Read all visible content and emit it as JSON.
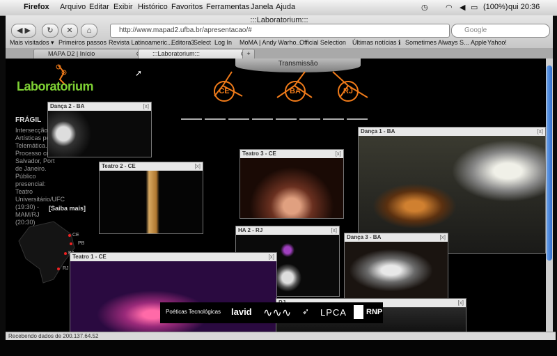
{
  "menubar": {
    "app": "Firefox",
    "items": [
      "Arquivo",
      "Editar",
      "Exibir",
      "Histórico",
      "Favoritos",
      "Ferramentas",
      "Janela",
      "Ajuda"
    ],
    "battery": "(100%)",
    "clock": "qui 20:36"
  },
  "window": {
    "title": ":::Laboratorium:::",
    "url": "http://www.mapad2.ufba.br/apresentacao/#",
    "search_placeholder": "Google"
  },
  "bookmarks": [
    "Mais visitados ▾",
    "Primeiros passos",
    "Revista Latinoameric...",
    "Editora3",
    "Select",
    "Log In",
    "MoMA | Andy Warho...",
    "Official Selection",
    "Últimas notícias ℹ",
    "Sometimes Always S...",
    "Apple",
    "Yahoo!"
  ],
  "tabs": [
    "MAPA D2 | Início",
    ":::Laboratorium:::"
  ],
  "page": {
    "logo": "Laboratorium",
    "transmission": "Transmissão",
    "nodes": [
      "CE",
      "BA",
      "RJ"
    ],
    "event_title": "FRÁGIL",
    "event_desc": "Intersecção de Artísticas pela Telemática. Processo cria Salvador, Port de Janeiro. Público presencial: Teatro Universitário/UFC (19:30) - MAM/RJ (20:30)",
    "saiba_mais": "[Saiba mais]",
    "map_labels": [
      "CE",
      "PB",
      "BA",
      "RJ"
    ],
    "close_glyph": "[x]",
    "videos": [
      {
        "title": "Dança 2 - BA"
      },
      {
        "title": "Teatro 2 - CE"
      },
      {
        "title": "Teatro 3 - CE"
      },
      {
        "title": "Dança 1 - BA"
      },
      {
        "title": "HA 2 - RJ"
      },
      {
        "title": "Dança 3 - BA"
      },
      {
        "title": "Teatro 1 - CE"
      },
      {
        "title": "RJ"
      }
    ],
    "sponsors": [
      "Poéticas Tecnológicas",
      "lavid",
      "LPCA",
      "RNP"
    ]
  },
  "status": "Recebendo dados de 200.137.64.52"
}
